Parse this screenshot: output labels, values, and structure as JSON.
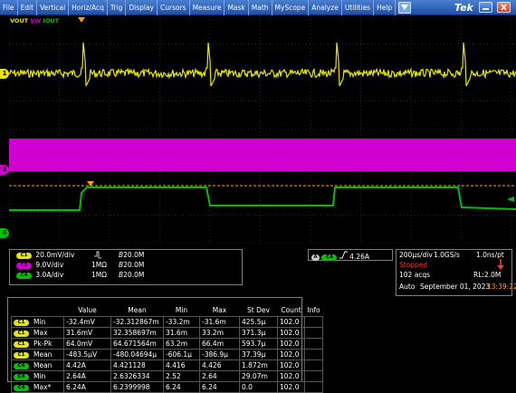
{
  "menu": {
    "items": [
      "File",
      "Edit",
      "Vertical",
      "Horiz/Acq",
      "Trig",
      "Display",
      "Cursors",
      "Measure",
      "Mask",
      "Math",
      "MyScope",
      "Analyze",
      "Utilities",
      "Help"
    ],
    "brand": "Tek"
  },
  "waveform": {
    "channel_labels": [
      {
        "text": "VOUT",
        "color": "#e6e600"
      },
      {
        "text": "SW",
        "color": "#d000d0"
      },
      {
        "text": "IOUT",
        "color": "#00c000"
      }
    ],
    "handles": [
      "1",
      "3",
      "4"
    ],
    "colors": {
      "ch1": "#e6e600",
      "ch3": "#d000d0",
      "ch4": "#00c000",
      "trigger": "#ff9900"
    }
  },
  "channels": [
    {
      "chip": "C1",
      "scale": "20.0mV/div",
      "coupling": "",
      "bw": "B",
      "bw_val": "20.0M"
    },
    {
      "chip": "C3",
      "scale": "9.0V/div",
      "coupling": "1MΩ",
      "bw": "B",
      "bw_val": "20.0M"
    },
    {
      "chip": "C4",
      "scale": "3.0A/div",
      "coupling": "1MΩ",
      "bw": "B",
      "bw_val": "20.0M"
    }
  ],
  "trigger": {
    "chip_a": "A",
    "chip_b": "C4",
    "level": "4.26A"
  },
  "acquisition": {
    "timebase": "200μs/div",
    "rate": "1.0GS/s",
    "resolution": "1.0ns/pt",
    "state": "Stopped",
    "acqs": "102 acqs",
    "rl": "RL:2.0M",
    "mode": "Auto",
    "date": "September 01, 2023",
    "time": "13:39:22"
  },
  "measurements": {
    "headers": [
      "Value",
      "Mean",
      "Min",
      "Max",
      "St Dev",
      "Count",
      "Info"
    ],
    "rows": [
      {
        "chip": "C1",
        "name": "Min",
        "value": "-32.4mV",
        "mean": "-32.312867m",
        "min": "-33.2m",
        "max": "-31.6m",
        "stdev": "425.5μ",
        "count": "102.0",
        "info": ""
      },
      {
        "chip": "C1",
        "name": "Max",
        "value": "31.6mV",
        "mean": "32.358697m",
        "min": "31.6m",
        "max": "33.2m",
        "stdev": "371.3μ",
        "count": "102.0",
        "info": ""
      },
      {
        "chip": "C1",
        "name": "Pk-Pk",
        "value": "64.0mV",
        "mean": "64.671564m",
        "min": "63.2m",
        "max": "66.4m",
        "stdev": "593.7μ",
        "count": "102.0",
        "info": ""
      },
      {
        "chip": "C1",
        "name": "Mean",
        "value": "-483.5μV",
        "mean": "-480.04694μ",
        "min": "-606.1μ",
        "max": "-386.9μ",
        "stdev": "37.39μ",
        "count": "102.0",
        "info": ""
      },
      {
        "chip": "C4",
        "name": "Mean",
        "value": "4.42A",
        "mean": "4.421128",
        "min": "4.416",
        "max": "4.426",
        "stdev": "1.872m",
        "count": "102.0",
        "info": ""
      },
      {
        "chip": "C4",
        "name": "Min",
        "value": "2.64A",
        "mean": "2.6326334",
        "min": "2.52",
        "max": "2.64",
        "stdev": "29.07m",
        "count": "102.0",
        "info": ""
      },
      {
        "chip": "C4",
        "name": "Max*",
        "value": "6.24A",
        "mean": "6.2399998",
        "min": "6.24",
        "max": "6.24",
        "stdev": "0.0",
        "count": "102.0",
        "info": ""
      }
    ]
  }
}
